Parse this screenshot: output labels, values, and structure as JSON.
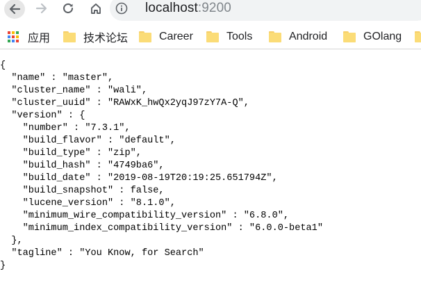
{
  "browser": {
    "url_host": "localhost",
    "url_port": ":9200",
    "back_icon": "arrow-left-icon",
    "forward_icon": "arrow-right-icon",
    "reload_icon": "reload-icon",
    "home_icon": "home-icon",
    "info_icon": "info-circle-icon"
  },
  "bookmarks": [
    {
      "label": "应用",
      "icon": "apps-grid-icon"
    },
    {
      "label": "技术论坛",
      "icon": "folder-icon"
    },
    {
      "label": "Career",
      "icon": "folder-icon"
    },
    {
      "label": "Tools",
      "icon": "folder-icon"
    },
    {
      "label": "Android",
      "icon": "folder-icon"
    },
    {
      "label": "GOlang",
      "icon": "folder-icon"
    }
  ],
  "colors": {
    "folder": "#fbdc77",
    "omnibox": "#f1f3f4",
    "apps": [
      "#ea4335",
      "#fbbc05",
      "#34a853",
      "#4285f4"
    ]
  },
  "json_lines": [
    "{",
    "  \"name\" : \"master\",",
    "  \"cluster_name\" : \"wali\",",
    "  \"cluster_uuid\" : \"RAWxK_hwQx2yqJ97zY7A-Q\",",
    "  \"version\" : {",
    "    \"number\" : \"7.3.1\",",
    "    \"build_flavor\" : \"default\",",
    "    \"build_type\" : \"zip\",",
    "    \"build_hash\" : \"4749ba6\",",
    "    \"build_date\" : \"2019-08-19T20:19:25.651794Z\",",
    "    \"build_snapshot\" : false,",
    "    \"lucene_version\" : \"8.1.0\",",
    "    \"minimum_wire_compatibility_version\" : \"6.8.0\",",
    "    \"minimum_index_compatibility_version\" : \"6.0.0-beta1\"",
    "  },",
    "  \"tagline\" : \"You Know, for Search\"",
    "}"
  ]
}
